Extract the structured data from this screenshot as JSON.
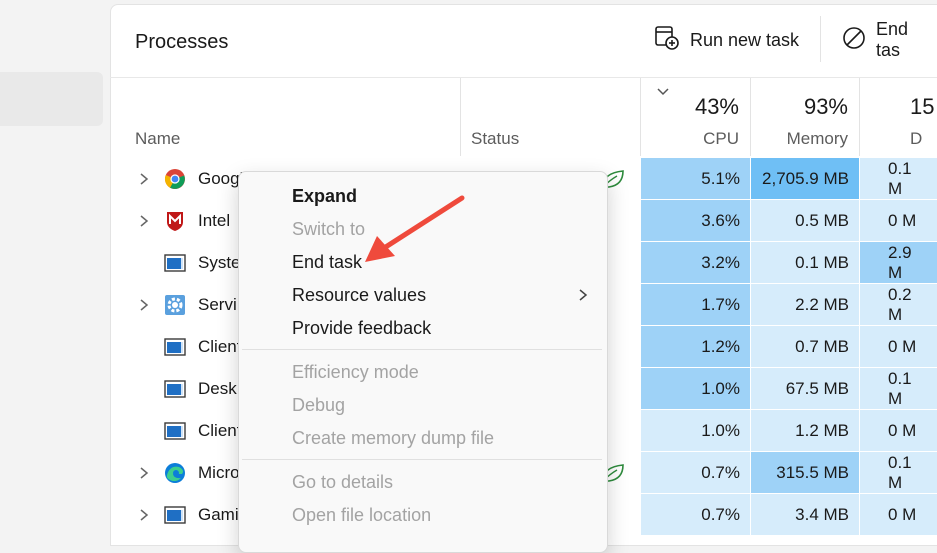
{
  "header": {
    "title": "Processes",
    "run_new_task": "Run new task",
    "end_task": "End tas"
  },
  "columns": {
    "name": "Name",
    "status": "Status",
    "cpu": {
      "pct": "43%",
      "label": "CPU"
    },
    "memory": {
      "pct": "93%",
      "label": "Memory"
    },
    "disk": {
      "pct": "15",
      "label": "D"
    }
  },
  "processes": [
    {
      "name": "Google",
      "expandable": true,
      "icon": "chrome-icon",
      "eco": true,
      "cpu": "5.1%",
      "memory": "2,705.9 MB",
      "disk": "0.1 M"
    },
    {
      "name": "Intel",
      "expandable": true,
      "icon": "mcafee-icon",
      "eco": false,
      "cpu": "3.6%",
      "memory": "0.5 MB",
      "disk": "0 M"
    },
    {
      "name": "Syste",
      "expandable": false,
      "icon": "window-app-icon",
      "eco": false,
      "cpu": "3.2%",
      "memory": "0.1 MB",
      "disk": "2.9 M"
    },
    {
      "name": "Servi",
      "expandable": true,
      "icon": "gear-icon",
      "eco": false,
      "cpu": "1.7%",
      "memory": "2.2 MB",
      "disk": "0.2 M"
    },
    {
      "name": "Client",
      "expandable": false,
      "icon": "window-app-icon",
      "eco": false,
      "cpu": "1.2%",
      "memory": "0.7 MB",
      "disk": "0 M"
    },
    {
      "name": "Desk",
      "expandable": false,
      "icon": "window-app-icon",
      "eco": false,
      "cpu": "1.0%",
      "memory": "67.5 MB",
      "disk": "0.1 M"
    },
    {
      "name": "Client",
      "expandable": false,
      "icon": "window-app-icon",
      "eco": false,
      "cpu": "1.0%",
      "memory": "1.2 MB",
      "disk": "0 M"
    },
    {
      "name": "Micro",
      "expandable": true,
      "icon": "edge-icon",
      "eco": true,
      "cpu": "0.7%",
      "memory": "315.5 MB",
      "disk": "0.1 M"
    },
    {
      "name": "Gami",
      "expandable": true,
      "icon": "window-app-icon",
      "eco": false,
      "cpu": "0.7%",
      "memory": "3.4 MB",
      "disk": "0 M"
    }
  ],
  "context_menu": {
    "items": [
      {
        "label": "Expand",
        "enabled": true,
        "bold": true
      },
      {
        "label": "Switch to",
        "enabled": false
      },
      {
        "label": "End task",
        "enabled": true
      },
      {
        "label": "Resource values",
        "enabled": true,
        "submenu": true
      },
      {
        "label": "Provide feedback",
        "enabled": true
      },
      {
        "label": "Efficiency mode",
        "enabled": false
      },
      {
        "label": "Debug",
        "enabled": false
      },
      {
        "label": "Create memory dump file",
        "enabled": false
      },
      {
        "label": "Go to details",
        "enabled": false
      },
      {
        "label": "Open file location",
        "enabled": false
      }
    ]
  },
  "colors": {
    "heat_high": "#9ed2f7",
    "heat_low": "#d6ecfb",
    "heat_peak": "#6fbff5",
    "annotation_arrow": "#ef4a3c"
  }
}
